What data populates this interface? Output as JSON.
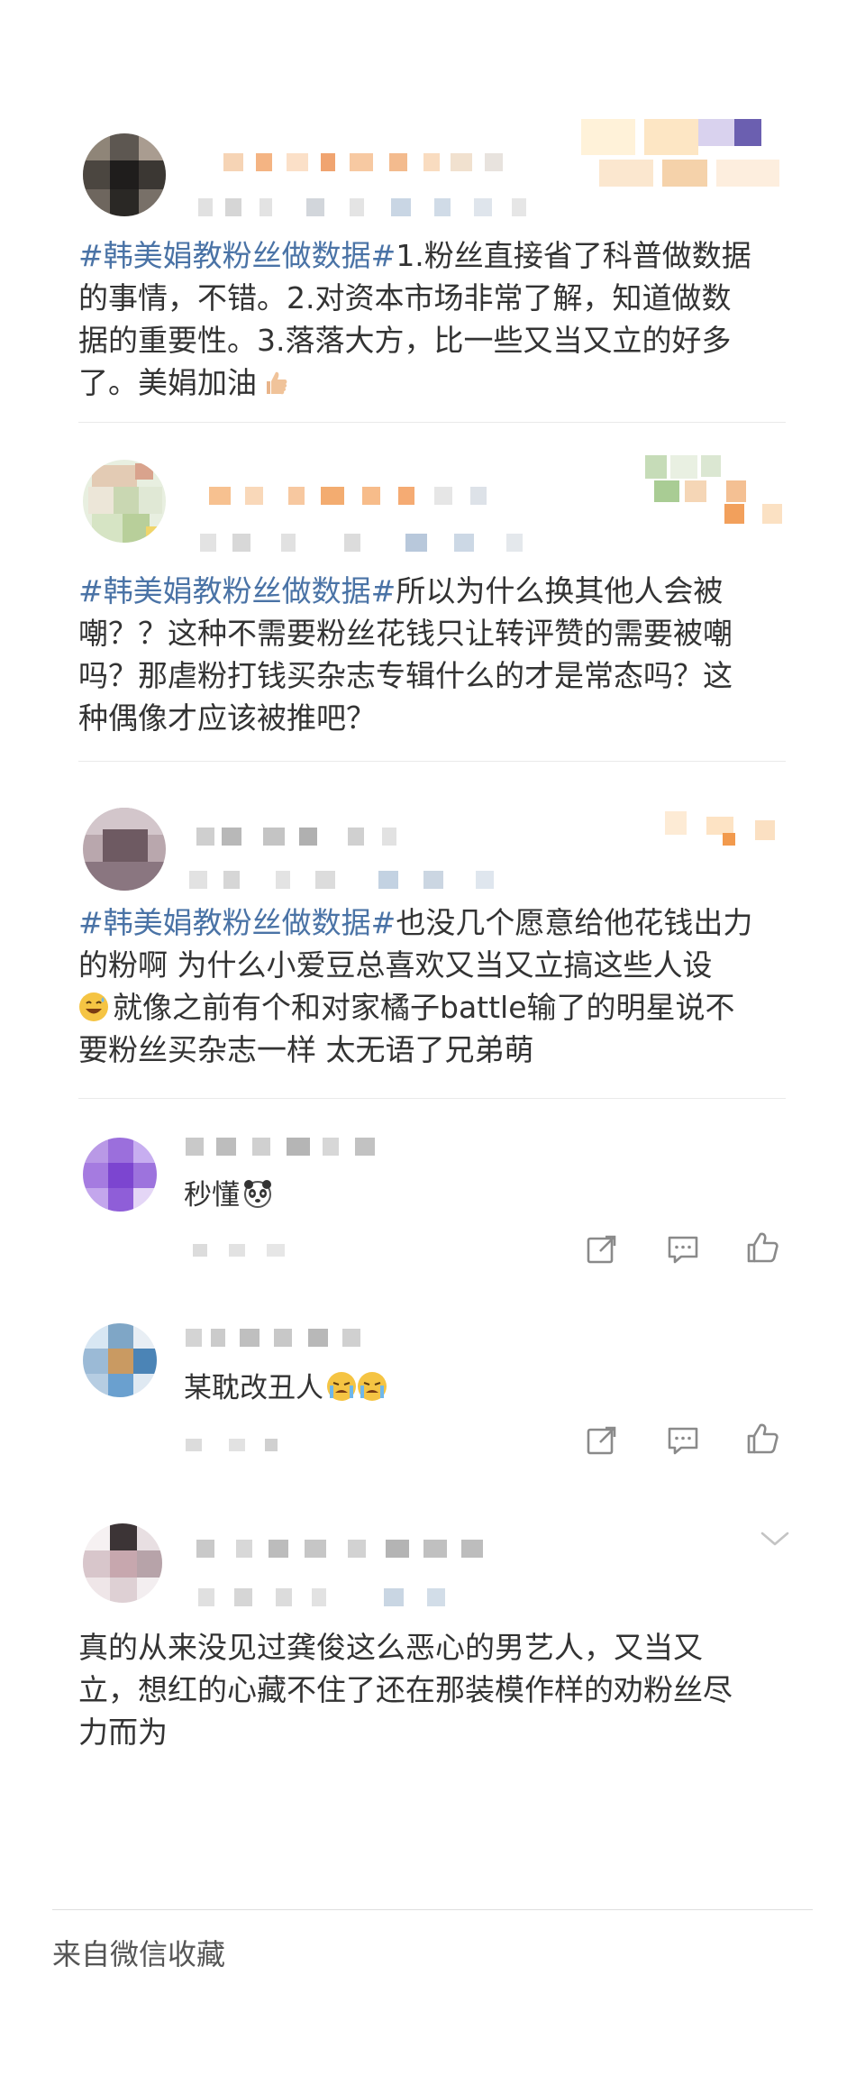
{
  "posts": [
    {
      "hashtag": "#韩美娟教粉丝做数据#",
      "lines": [
        "1.粉丝直接省了科普做数据",
        "的事情，不错。2.对资本市场非常了解，知道做数",
        "据的重要性。3.落落大方，比一些又当又立的好多",
        "了。美娟加油"
      ],
      "emoji_icon": "thumbs-up-emoji"
    },
    {
      "hashtag": "#韩美娟教粉丝做数据#",
      "lines": [
        "所以为什么换其他人会被",
        "嘲？？这种不需要粉丝花钱只让转评赞的需要被嘲",
        "吗？那虐粉打钱买杂志专辑什么的才是常态吗？这",
        "种偶像才应该被推吧？"
      ]
    },
    {
      "hashtag": "#韩美娟教粉丝做数据#",
      "lines": [
        "也没几个愿意给他花钱出力",
        "的粉啊 为什么小爱豆总喜欢又当又立搞这些人设",
        "就像之前有个和对家橘子battle输了的明星说不",
        "要粉丝买杂志一样 太无语了兄弟萌"
      ],
      "emoji_icon": "grinning-sweat-emoji"
    }
  ],
  "replies": [
    {
      "text": "秒懂",
      "emoji_icons": [
        "panda-emoji"
      ]
    },
    {
      "text": "某耽改丑人",
      "emoji_icons": [
        "crying-emoji",
        "crying-emoji"
      ]
    }
  ],
  "last_post": {
    "lines": [
      "真的从来没见过龚俊这么恶心的男艺人，又当又",
      "立，想红的心藏不住了还在那装模作样的劝粉丝尽",
      "力而为"
    ]
  },
  "footer": {
    "source": "来自微信收藏"
  },
  "actions": [
    "share-icon",
    "comment-icon",
    "like-icon"
  ],
  "colors": {
    "hashtag": "#4a73a6",
    "text": "#333333",
    "icon": "#8a8a8a"
  }
}
